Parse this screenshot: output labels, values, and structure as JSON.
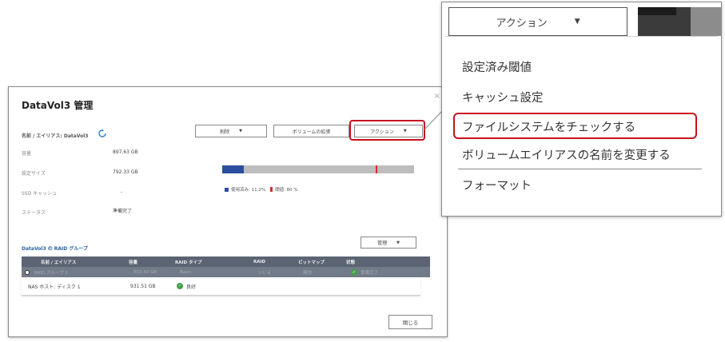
{
  "dialog": {
    "title": "DataVol3 管理",
    "close_glyph": "×",
    "volume_label": "名前 / エイリアス: DataVol3",
    "buttons": {
      "delete": "削除",
      "expand": "ボリュームの拡張",
      "action": "アクション",
      "manage": "管理",
      "close": "閉じる"
    },
    "properties": [
      {
        "label": "容量",
        "value": "897.63 GB"
      },
      {
        "label": "設定サイズ",
        "value": "792.33 GB"
      },
      {
        "label": "SSD キャッシュ",
        "value": "-"
      },
      {
        "label": "ステータス",
        "value": "準備完了"
      }
    ],
    "usage": {
      "used_fraction": 0.112,
      "threshold_fraction": 0.8,
      "legend_used": "使用済み: 11.2%",
      "legend_threshold": "閾値: 80 %"
    },
    "raid_section_title": "DataVol3 の RAID グループ",
    "table": {
      "headers": [
        "名前 / エイリアス",
        "容量",
        "RAID タイプ",
        "RAID",
        "ビットマップ",
        "状態"
      ],
      "group_row": [
        "RAID グループ 1",
        "502.40 GB",
        "Basic",
        "いいえ",
        "無効",
        "準備完了"
      ],
      "disk_row": {
        "name": "NAS ホスト: ディスク 1",
        "capacity": "931.51 GB",
        "status": "良好"
      }
    }
  },
  "zoom_menu": {
    "action_label": "アクション",
    "items": [
      "設定済み閾値",
      "キャッシュ設定",
      "ファイルシステムをチェックする",
      "ボリュームエイリアスの名前を変更する",
      "フォーマット"
    ]
  },
  "colors": {
    "highlight": "#c8101e",
    "usage_bar": "#2a4f9e",
    "table_header": "#5b6472",
    "ok": "#43a047"
  }
}
